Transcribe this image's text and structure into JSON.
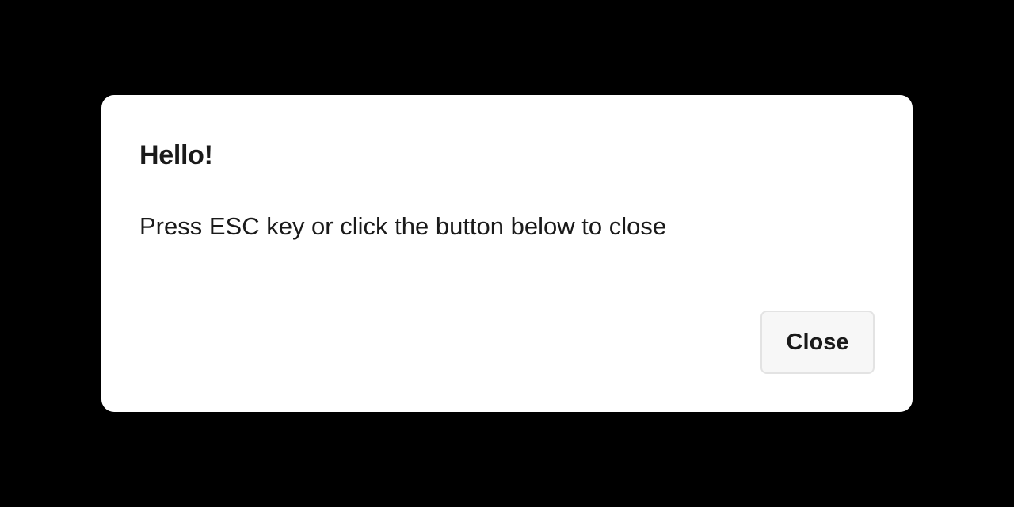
{
  "dialog": {
    "title": "Hello!",
    "message": "Press ESC key or click the button below to close",
    "close_label": "Close"
  },
  "colors": {
    "backdrop": "#000000",
    "dialog_background": "#ffffff",
    "text": "#1a1a1a",
    "button_background": "#f7f7f7",
    "button_border": "#e3e3e3"
  }
}
